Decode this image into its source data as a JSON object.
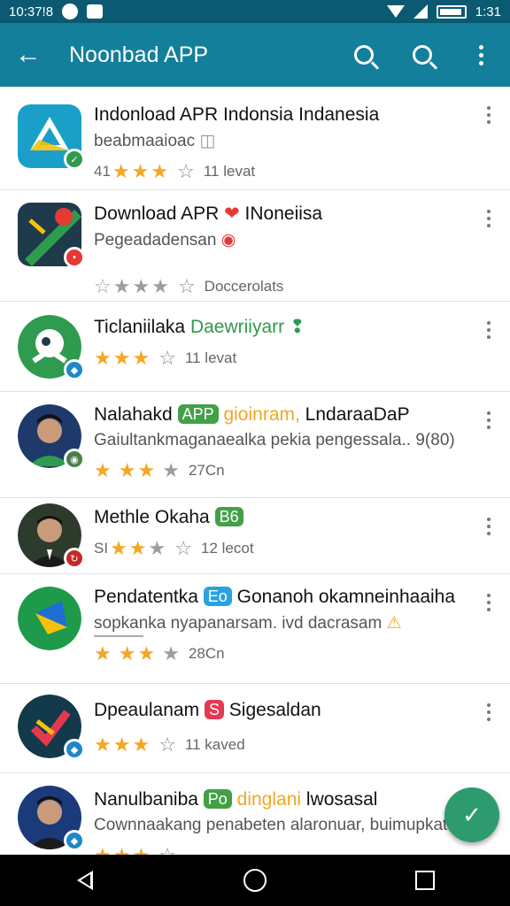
{
  "status_bar": {
    "time_left": "10:37!8",
    "time_right": "1:31"
  },
  "app_bar": {
    "title": "Noonbad APP",
    "back": "←"
  },
  "rows": [
    {
      "title": "Indonload APR Indonsia Indanesia",
      "subtitle": "beabmaaioac",
      "rating_text": "11 levat",
      "rating_prefix": "41",
      "stars": [
        1,
        1,
        1,
        0,
        0
      ],
      "icon_color": "#1aa0c8",
      "badge_color": "#2e9b4f"
    },
    {
      "title": "Download APR",
      "title_tail": "INoneiisa",
      "subtitle": "Pegeadadensan",
      "rating_text": "Doccerolats",
      "stars": [
        0,
        0,
        0,
        0,
        0
      ],
      "icon_color": "#1f3a4a",
      "badge_color": "#e53935"
    },
    {
      "title": "Ticlaniilaka",
      "title_tail": "Daewriiyarr",
      "rating_text": "11 levat",
      "stars": [
        1,
        1,
        1,
        0,
        0
      ],
      "icon_color": "#2e9b4f",
      "badge_color": "#1e88c8"
    },
    {
      "title": "Nalahakd",
      "chip": "APP",
      "title_tail": "gioinram,",
      "title_tail2": "LndaraaDaP",
      "subtitle": "Gaiultankmaganaealka pekia pengessala.. 9(80)",
      "rating_text": "27Cn",
      "stars": [
        1,
        1,
        1,
        0,
        0
      ],
      "icon_color": "#1e3a6a",
      "badge_color": "#4a7d4a"
    },
    {
      "title": "Methle Okaha",
      "chip": "B6",
      "rating_prefix": "SI",
      "rating_text": "12 lecot",
      "stars": [
        1,
        1,
        0,
        0,
        0
      ],
      "icon_color": "#2d3b2d",
      "badge_color": "#c62828"
    },
    {
      "title": "Pendatentka",
      "chip": "Eo",
      "title_tail": "Gonanoh okamneinhaaiha",
      "subtitle": "sopkanka nyapanarsam. ivd dacrasam",
      "rating_text": "28Cn",
      "stars": [
        1,
        1,
        1,
        0,
        0
      ],
      "icon_color": "#1e9a4a",
      "badge_color": "#ffffff"
    },
    {
      "title": "Dpeaulanam",
      "chip": "S",
      "title_tail": "Sigesaldan",
      "rating_text": "11 kaved",
      "stars": [
        1,
        1,
        1,
        0,
        0
      ],
      "icon_color": "#123a4a",
      "badge_color": "#1e88c8"
    },
    {
      "title": "Nanulbaniba",
      "chip": "Po",
      "title_tail": "dinglani",
      "title_tail2": "lwosasal",
      "subtitle": "Cownnaakang penabeten alaronuar, buimupkat",
      "rating_text": "",
      "stars": [
        1,
        1,
        1,
        0,
        0
      ],
      "icon_color": "#1a3a7a",
      "badge_color": "#1e88c8"
    }
  ],
  "colors": {
    "status_bar": "#0b5a72",
    "app_bar": "#137f9a",
    "fab": "#2e9b6f",
    "star_on": "#f5a623",
    "chip_green": "#43a047",
    "chip_blue": "#29a3e0",
    "chip_red": "#e53950"
  },
  "icons": {
    "back": "arrow-left-icon",
    "search": "search-icon",
    "more": "more-vert-icon",
    "fab": "check-icon"
  }
}
